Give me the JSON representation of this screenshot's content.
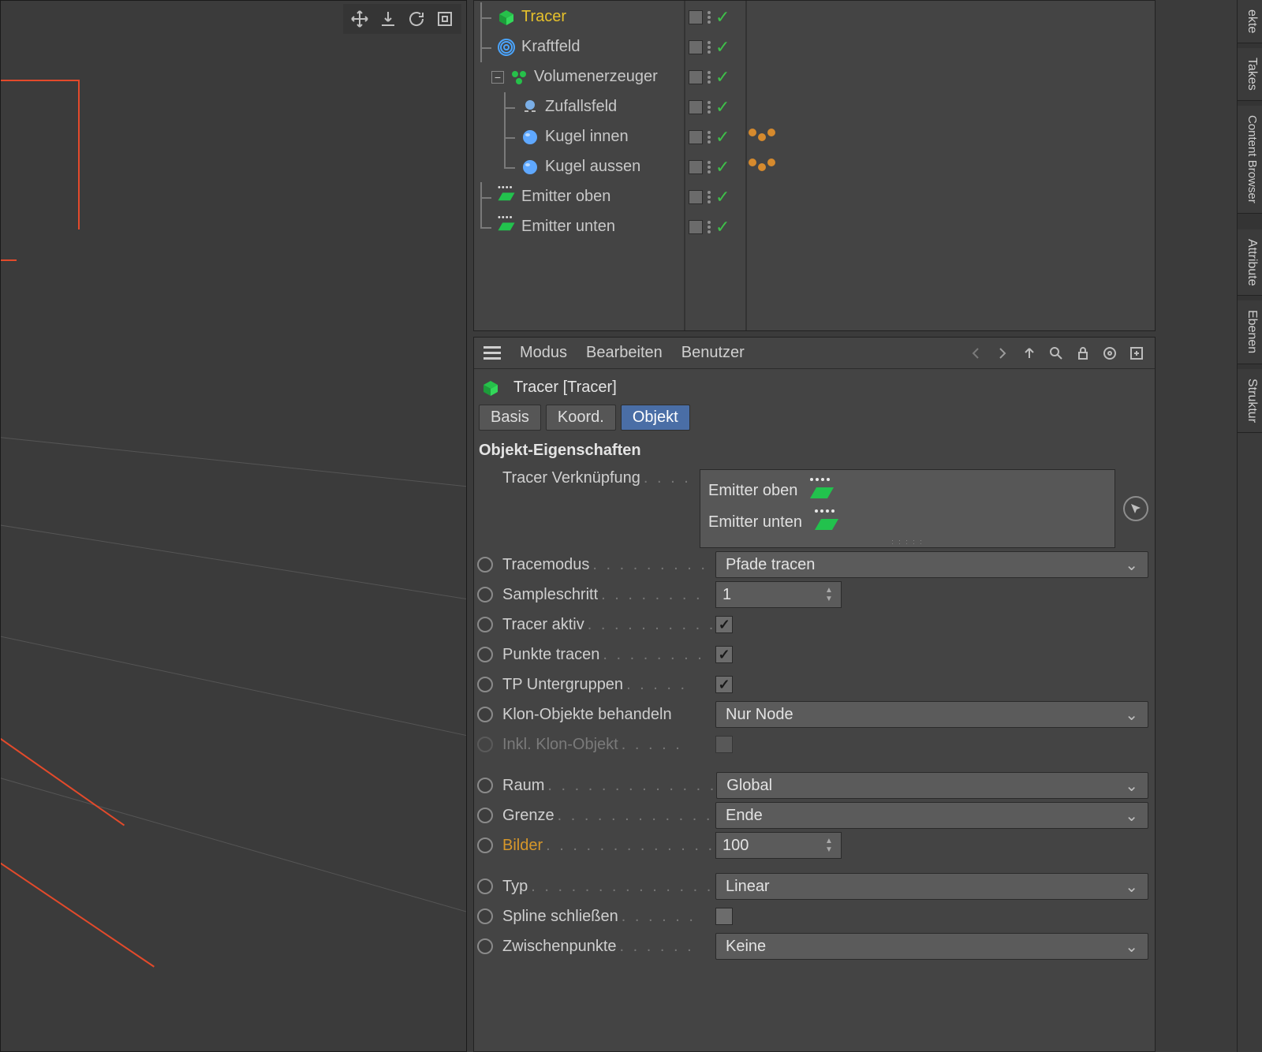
{
  "viewport": {
    "tool_move": "move",
    "tool_down": "drop",
    "tool_rotate": "rotate",
    "tool_frame": "frame"
  },
  "object_manager": {
    "items": [
      {
        "name": "Tracer",
        "icon": "tracer-cube",
        "indent": 1,
        "selected": true,
        "tags": [
          "vis",
          "check"
        ]
      },
      {
        "name": "Kraftfeld",
        "icon": "forcefield",
        "indent": 1,
        "selected": false,
        "tags": [
          "vis",
          "check"
        ]
      },
      {
        "name": "Volumenerzeuger",
        "icon": "builder",
        "indent": 0,
        "selected": false,
        "tags": [
          "vis",
          "check"
        ],
        "expandable": true
      },
      {
        "name": "Zufallsfeld",
        "icon": "random",
        "indent": 2,
        "selected": false,
        "tags": [
          "vis",
          "check"
        ]
      },
      {
        "name": "Kugel innen",
        "icon": "sphere",
        "indent": 2,
        "selected": false,
        "tags": [
          "vis",
          "check",
          "beads"
        ]
      },
      {
        "name": "Kugel aussen",
        "icon": "sphere",
        "indent": 2,
        "selected": false,
        "tags": [
          "vis",
          "check",
          "beads"
        ]
      },
      {
        "name": "Emitter oben",
        "icon": "emitter",
        "indent": 1,
        "selected": false,
        "tags": [
          "vis",
          "check"
        ]
      },
      {
        "name": "Emitter unten",
        "icon": "emitter",
        "indent": 1,
        "selected": false,
        "tags": [
          "vis",
          "check"
        ]
      }
    ]
  },
  "attributes": {
    "menu": {
      "mode": "Modus",
      "edit": "Bearbeiten",
      "user": "Benutzer"
    },
    "header": "Tracer [Tracer]",
    "tabs": {
      "basis": "Basis",
      "coord": "Koord.",
      "object": "Objekt"
    },
    "section_title": "Objekt-Eigenschaften",
    "link": {
      "label": "Tracer Verknüpfung",
      "entries": [
        "Emitter oben",
        "Emitter unten"
      ]
    },
    "tracemode": {
      "label": "Tracemodus",
      "value": "Pfade tracen"
    },
    "samplestep": {
      "label": "Sampleschritt",
      "value": "1"
    },
    "tracer_active": {
      "label": "Tracer aktiv",
      "checked": true
    },
    "trace_points": {
      "label": "Punkte tracen",
      "checked": true
    },
    "tp_subgroups": {
      "label": "TP Untergruppen",
      "checked": true
    },
    "clone_handle": {
      "label": "Klon-Objekte behandeln",
      "value": "Nur Node"
    },
    "incl_clone": {
      "label": "Inkl. Klon-Objekt",
      "checked": false,
      "disabled": true
    },
    "space": {
      "label": "Raum",
      "value": "Global"
    },
    "limit": {
      "label": "Grenze",
      "value": "Ende"
    },
    "frames": {
      "label": "Bilder",
      "value": "100",
      "highlight": true
    },
    "type": {
      "label": "Typ",
      "value": "Linear"
    },
    "close_spline": {
      "label": "Spline schließen",
      "checked": false
    },
    "intermediate": {
      "label": "Zwischenpunkte",
      "value": "Keine"
    }
  },
  "side_tabs": {
    "objects": "ekte",
    "takes": "Takes",
    "content": "Content Browser",
    "attribute": "Attribute",
    "layers": "Ebenen",
    "structure": "Struktur"
  }
}
